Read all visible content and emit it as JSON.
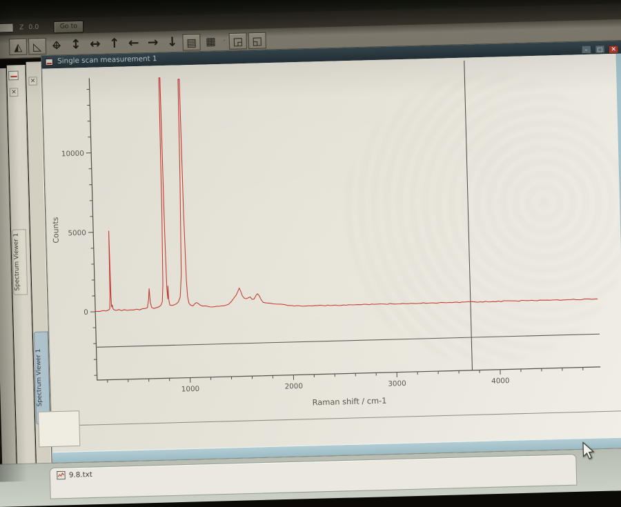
{
  "top_controls": {
    "spin_glyph": "◂",
    "field_value": "",
    "z_label": "Z",
    "z_value": "0.0",
    "goto_label": "Go to"
  },
  "toolbar": {
    "icons": [
      {
        "name": "video-view-icon",
        "glyph": "◭",
        "kind": "boxed"
      },
      {
        "name": "pan-tool-icon",
        "glyph": "◺",
        "kind": "boxed"
      },
      {
        "name": "move-xy-icon",
        "glyph": "↔",
        "glyph2": "↕",
        "kind": "tool"
      },
      {
        "name": "move-z-icon",
        "glyph": "↕",
        "kind": "arrow"
      },
      {
        "name": "step-x-icon",
        "glyph": "↔",
        "kind": "arrow"
      },
      {
        "name": "stage-up-icon",
        "glyph": "↑",
        "kind": "arrow"
      },
      {
        "name": "stage-left-icon",
        "glyph": "←",
        "kind": "arrow"
      },
      {
        "name": "stage-right-icon",
        "glyph": "→",
        "kind": "arrow"
      },
      {
        "name": "stage-down-icon",
        "glyph": "↓",
        "kind": "arrow"
      },
      {
        "name": "snapshot-icon",
        "glyph": "▤",
        "kind": "boxed"
      },
      {
        "name": "grid-map-icon",
        "glyph": "▦",
        "kind": "tool"
      },
      {
        "name": "separator-dot",
        "glyph": "·",
        "kind": "sep"
      },
      {
        "name": "export-image-icon",
        "glyph": "◲",
        "kind": "boxed"
      },
      {
        "name": "export-chart-icon",
        "glyph": "◱",
        "kind": "boxed"
      }
    ]
  },
  "sidebar": {
    "close_glyph": "×",
    "panels": [
      {
        "tab_label": "Spectrum Viewer 1",
        "active": false
      },
      {
        "tab_label": "Spectrum Viewer 1",
        "active": true
      }
    ]
  },
  "window": {
    "title": "Single scan measurement 1",
    "minimize_glyph": "–",
    "maximize_glyph": "□",
    "close_glyph": "×"
  },
  "files": {
    "items": [
      {
        "label": "9.8.txt"
      }
    ]
  },
  "colors": {
    "spectrum_red": "#c2332b",
    "titlebar": "#2c3c43",
    "close_red": "#b23a2c",
    "window_frame_blue": "#a2c1ca",
    "chart_bg": "#e3e0d6",
    "axis": "#504f47",
    "crosshair": "#45453f"
  },
  "chart_data": {
    "type": "line",
    "title": "",
    "xlabel": "Raman shift / cm-1",
    "ylabel": "Counts",
    "xlim": [
      100,
      4970
    ],
    "ylim": [
      -4300,
      14700
    ],
    "x_major_ticks": [
      1000,
      2000,
      3000,
      4000
    ],
    "x_minor_step": 200,
    "y_major_ticks": [
      0,
      5000,
      10000
    ],
    "y_minor_step": 1000,
    "grid": false,
    "legend": "none",
    "line_color": "#c2332b",
    "crosshair": {
      "x": 3730,
      "y": -2230
    },
    "series": [
      {
        "name": "9.8.txt",
        "points": [
          [
            100,
            40
          ],
          [
            140,
            15
          ],
          [
            175,
            55
          ],
          [
            205,
            25
          ],
          [
            228,
            70
          ],
          [
            240,
            160
          ],
          [
            246,
            900
          ],
          [
            250,
            5050
          ],
          [
            254,
            1100
          ],
          [
            258,
            300
          ],
          [
            266,
            420
          ],
          [
            272,
            150
          ],
          [
            285,
            60
          ],
          [
            305,
            45
          ],
          [
            330,
            75
          ],
          [
            355,
            35
          ],
          [
            380,
            60
          ],
          [
            410,
            45
          ],
          [
            440,
            70
          ],
          [
            470,
            40
          ],
          [
            500,
            85
          ],
          [
            530,
            55
          ],
          [
            560,
            95
          ],
          [
            585,
            130
          ],
          [
            605,
            180
          ],
          [
            618,
            700
          ],
          [
            626,
            1360
          ],
          [
            634,
            500
          ],
          [
            645,
            180
          ],
          [
            665,
            120
          ],
          [
            690,
            150
          ],
          [
            715,
            200
          ],
          [
            735,
            320
          ],
          [
            750,
            520
          ],
          [
            760,
            1600
          ],
          [
            768,
            6000
          ],
          [
            773,
            14600
          ],
          [
            783,
            14600
          ],
          [
            790,
            5000
          ],
          [
            797,
            1400
          ],
          [
            803,
            700
          ],
          [
            808,
            1500
          ],
          [
            813,
            650
          ],
          [
            822,
            330
          ],
          [
            840,
            260
          ],
          [
            860,
            300
          ],
          [
            885,
            380
          ],
          [
            905,
            480
          ],
          [
            925,
            800
          ],
          [
            940,
            2200
          ],
          [
            952,
            8000
          ],
          [
            958,
            14500
          ],
          [
            970,
            14500
          ],
          [
            978,
            6000
          ],
          [
            988,
            1800
          ],
          [
            996,
            800
          ],
          [
            1006,
            420
          ],
          [
            1020,
            260
          ],
          [
            1045,
            230
          ],
          [
            1065,
            360
          ],
          [
            1080,
            430
          ],
          [
            1095,
            340
          ],
          [
            1115,
            240
          ],
          [
            1140,
            190
          ],
          [
            1170,
            160
          ],
          [
            1210,
            140
          ],
          [
            1255,
            130
          ],
          [
            1300,
            150
          ],
          [
            1345,
            170
          ],
          [
            1390,
            260
          ],
          [
            1420,
            420
          ],
          [
            1445,
            650
          ],
          [
            1465,
            800
          ],
          [
            1482,
            1050
          ],
          [
            1497,
            1260
          ],
          [
            1510,
            1050
          ],
          [
            1525,
            780
          ],
          [
            1545,
            600
          ],
          [
            1565,
            560
          ],
          [
            1585,
            620
          ],
          [
            1600,
            660
          ],
          [
            1618,
            540
          ],
          [
            1638,
            560
          ],
          [
            1658,
            780
          ],
          [
            1672,
            870
          ],
          [
            1688,
            740
          ],
          [
            1705,
            480
          ],
          [
            1725,
            340
          ],
          [
            1755,
            280
          ],
          [
            1790,
            240
          ],
          [
            1825,
            215
          ],
          [
            1860,
            200
          ],
          [
            1895,
            180
          ],
          [
            1930,
            140
          ],
          [
            1965,
            95
          ],
          [
            2000,
            55
          ],
          [
            2050,
            30
          ],
          [
            2120,
            25
          ],
          [
            2200,
            18
          ],
          [
            2300,
            22
          ],
          [
            2400,
            12
          ],
          [
            2500,
            18
          ],
          [
            2600,
            8
          ],
          [
            2700,
            14
          ],
          [
            2800,
            6
          ],
          [
            2900,
            10
          ],
          [
            3000,
            4
          ],
          [
            3100,
            8
          ],
          [
            3200,
            2
          ],
          [
            3300,
            6
          ],
          [
            3400,
            0
          ],
          [
            3500,
            4
          ],
          [
            3600,
            -2
          ],
          [
            3700,
            2
          ],
          [
            3800,
            -4
          ],
          [
            3900,
            0
          ],
          [
            4000,
            -6
          ],
          [
            4100,
            -2
          ],
          [
            4200,
            -8
          ],
          [
            4300,
            -4
          ],
          [
            4400,
            -12
          ],
          [
            4500,
            -8
          ],
          [
            4600,
            -16
          ],
          [
            4700,
            -12
          ],
          [
            4800,
            -20
          ],
          [
            4880,
            -16
          ],
          [
            4960,
            -22
          ]
        ]
      }
    ]
  }
}
